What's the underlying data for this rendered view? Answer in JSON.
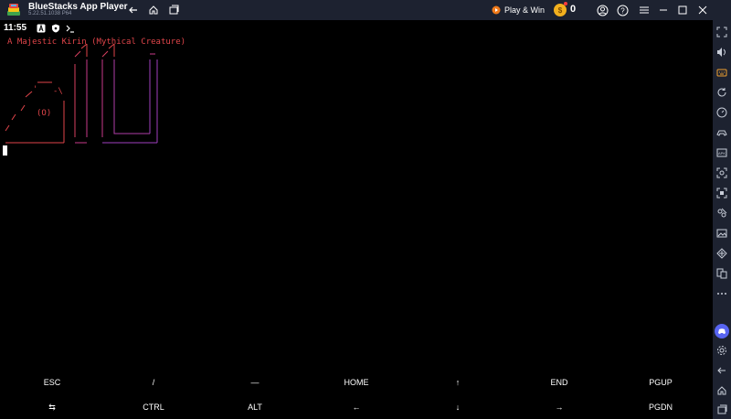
{
  "window": {
    "app_name": "BlueStacks App Player",
    "version": "5.22.51.1038  P64",
    "play_win_label": "Play & Win",
    "coin_count": "0",
    "icons": [
      "back-icon",
      "home-icon",
      "multitask-icon",
      "play-win-icon",
      "coin-icon",
      "account-icon",
      "help-icon",
      "menu-icon",
      "minimize-icon",
      "maximize-icon",
      "close-icon"
    ]
  },
  "sidebar": {
    "icons": [
      "expand-icon",
      "volume-icon",
      "keyboard-controls-icon",
      "rotate-icon",
      "speed-icon",
      "gamepad-icon",
      "apk-icon",
      "screenshot-icon",
      "record-icon",
      "macro-icon",
      "media-folder-icon",
      "location-icon",
      "multi-instance-icon",
      "more-icon",
      "discord-icon",
      "settings-icon",
      "back-icon",
      "home-icon",
      "recent-apps-icon"
    ]
  },
  "statusbar": {
    "time": "11:55",
    "icons": [
      "a-notification-icon",
      "shield-notification-icon",
      "terminal-prompt-icon"
    ]
  },
  "terminal": {
    "title_line": "A Majestic Kirin (Mythical Creature)",
    "ascii_colors": [
      "#e0454a",
      "#c83a8a",
      "#a040c0"
    ]
  },
  "extra_keys": {
    "row1": [
      "ESC",
      "/",
      "—",
      "HOME",
      "↑",
      "END",
      "PGUP"
    ],
    "row2": [
      "⇆",
      "CTRL",
      "ALT",
      "←",
      "↓",
      "→",
      "PGDN"
    ]
  }
}
